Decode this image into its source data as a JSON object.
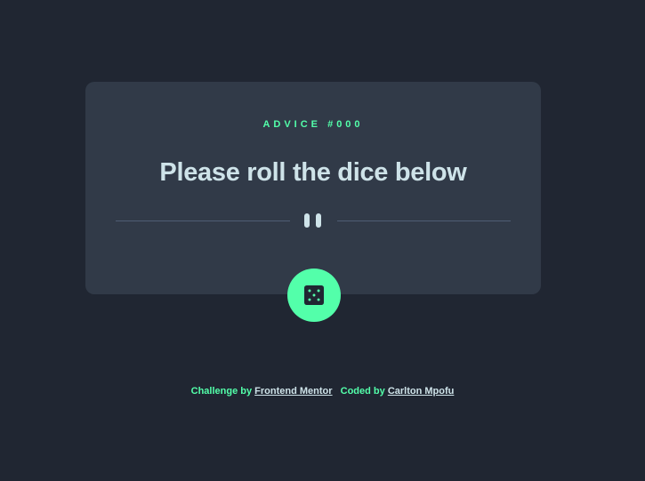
{
  "card": {
    "label": "ADVICE #000",
    "advice": "Please roll the dice below"
  },
  "divider": {
    "icon": "pause-icon"
  },
  "dice_button": {
    "icon": "dice-icon"
  },
  "footer": {
    "challenge_label": "Challenge by",
    "challenge_link": "Frontend Mentor",
    "coded_label": "Coded by",
    "coded_link": "Carlton Mpofu"
  },
  "colors": {
    "background": "#202632",
    "card": "#313a48",
    "accent": "#53ffaa",
    "text": "#cee3e9",
    "divider": "#4f5d74"
  }
}
